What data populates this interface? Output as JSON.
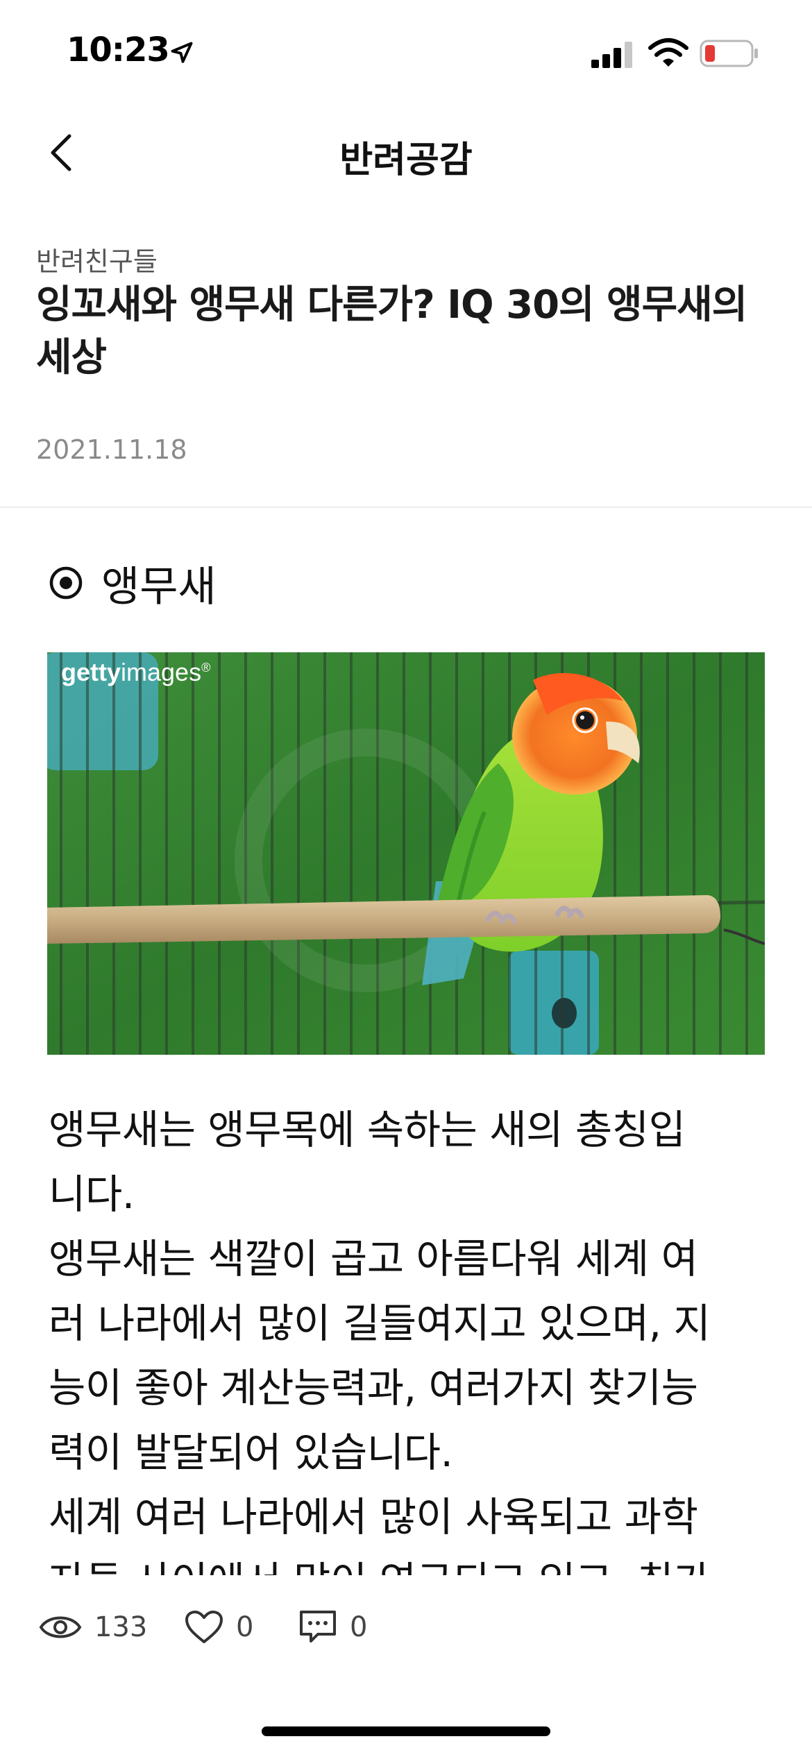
{
  "status_bar": {
    "time": "10:23",
    "icons": [
      "location-arrow-icon",
      "cellular-signal-icon",
      "wifi-icon",
      "battery-low-icon"
    ],
    "battery_color": "#e53935"
  },
  "nav": {
    "title": "반려공감",
    "back_icon": "chevron-left-icon"
  },
  "article": {
    "category": "반려친구들",
    "title_lines": [
      "잉꼬새와 앵무새 다른가? IQ 30의 앵무새의",
      "세상"
    ],
    "date": "2021.11.18",
    "section_icon": "radio-dot-icon",
    "section_label": "앵무새",
    "image": {
      "watermark": [
        "getty",
        "images",
        "®"
      ],
      "subject": "green-orange lovebird on perch"
    },
    "body_lines": [
      "앵무새는 앵무목에 속하는 새의 총칭입",
      "니다.",
      "앵무새는 색깔이 곱고 아름다워 세계 여",
      "러 나라에서 많이 길들여지고 있으며, 지",
      "능이 좋아 계산능력과, 여러가지 찾기능",
      "력이 발달되어 있습니다.",
      "세계 여러 나라에서 많이 사육되고 과학",
      "자들 사이에서 많이 연구되고 있고, 최가"
    ]
  },
  "stats": {
    "views": "133",
    "likes": "0",
    "comments": "0",
    "icons": [
      "eye-icon",
      "heart-icon",
      "comment-icon"
    ]
  }
}
